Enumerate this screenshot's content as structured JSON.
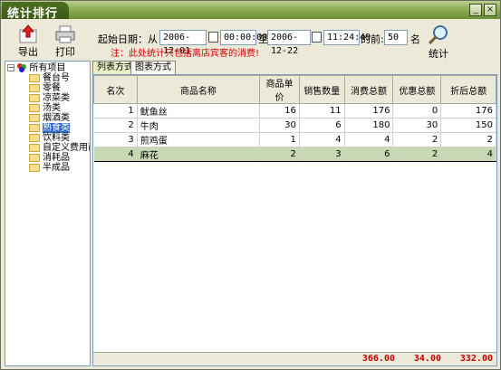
{
  "window": {
    "title": "统计排行",
    "minimize": "_",
    "close": "×"
  },
  "toolbar": {
    "export_label": "导出",
    "print_label": "打印",
    "stats_label": "统计"
  },
  "filter": {
    "start_label": "起始日期：从",
    "start_date": "2006-12-01",
    "start_time": "00:00:00",
    "to_label": "至",
    "end_date": "2006-12-22",
    "end_time": "11:24:49",
    "top_label": "的前:",
    "top_count": "50",
    "top_unit": "名",
    "note": "注：此处统计只包括离店宾客的消费!"
  },
  "tree": {
    "root": "所有项目",
    "items": [
      {
        "label": "餐台号",
        "selected": false
      },
      {
        "label": "零餐",
        "selected": false
      },
      {
        "label": "凉菜类",
        "selected": false
      },
      {
        "label": "汤类",
        "selected": false
      },
      {
        "label": "烟酒类",
        "selected": false
      },
      {
        "label": "熟食类",
        "selected": true
      },
      {
        "label": "饮料类",
        "selected": false
      },
      {
        "label": "自定义费用商",
        "selected": false
      },
      {
        "label": "消耗品",
        "selected": false
      },
      {
        "label": "半成品",
        "selected": false
      }
    ]
  },
  "tabs": {
    "list": "列表方式",
    "chart": "图表方式"
  },
  "table": {
    "columns": [
      "名次",
      "商品名称",
      "商品单价",
      "销售数量",
      "消费总额",
      "优惠总额",
      "折后总额"
    ],
    "rows": [
      [
        "1",
        "鱿鱼丝",
        "16",
        "11",
        "176",
        "0",
        "176"
      ],
      [
        "2",
        "牛肉",
        "30",
        "6",
        "180",
        "30",
        "150"
      ],
      [
        "3",
        "煎鸡蛋",
        "1",
        "4",
        "4",
        "2",
        "2"
      ],
      [
        "4",
        "麻花",
        "2",
        "3",
        "6",
        "2",
        "4"
      ]
    ],
    "selected_row": 3,
    "totals": {
      "consume": "366.00",
      "discount": "34.00",
      "after": "332.00"
    }
  },
  "colors": {
    "titlebar": "#8fae56",
    "note": "#d40000",
    "totals": "#c00000",
    "selected_row": "#c9d8b4"
  }
}
